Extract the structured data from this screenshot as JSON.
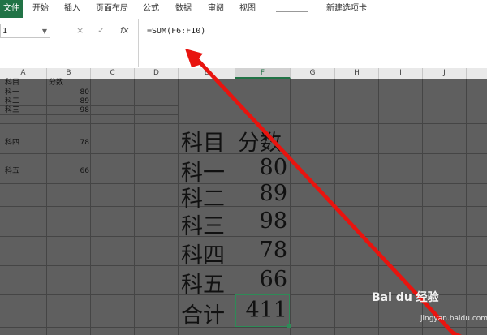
{
  "ribbon": {
    "file_tab": "文件",
    "tabs": [
      "开始",
      "插入",
      "页面布局",
      "公式",
      "数据",
      "审阅",
      "视图",
      "新建选项卡"
    ]
  },
  "formula_bar": {
    "name_box": "1",
    "cancel_icon": "×",
    "enter_icon": "✓",
    "fx_label": "fx",
    "formula": "=SUM(F6:F10)"
  },
  "columns": [
    "A",
    "B",
    "C",
    "D",
    "E",
    "F",
    "G",
    "H",
    "I",
    "J"
  ],
  "small_table": {
    "header": [
      "科目",
      "分数"
    ],
    "rows": [
      {
        "label": "科一",
        "value": "80"
      },
      {
        "label": "科二",
        "value": "89"
      },
      {
        "label": "科三",
        "value": "98"
      },
      {
        "label": "科四",
        "value": "78"
      },
      {
        "label": "科五",
        "value": "66"
      }
    ]
  },
  "big_table": {
    "header": [
      "科目",
      "分数"
    ],
    "rows": [
      {
        "label": "科一",
        "value": "80"
      },
      {
        "label": "科二",
        "value": "89"
      },
      {
        "label": "科三",
        "value": "98"
      },
      {
        "label": "科四",
        "value": "78"
      },
      {
        "label": "科五",
        "value": "66"
      }
    ],
    "total_label": "合计",
    "total_value": "411"
  },
  "watermark": {
    "logo": "Bai du 经验",
    "site": "jingyan.baidu.com"
  },
  "colors": {
    "accent": "#217346",
    "arrow": "#e8140f",
    "sheet_bg": "#5f5f5f"
  }
}
